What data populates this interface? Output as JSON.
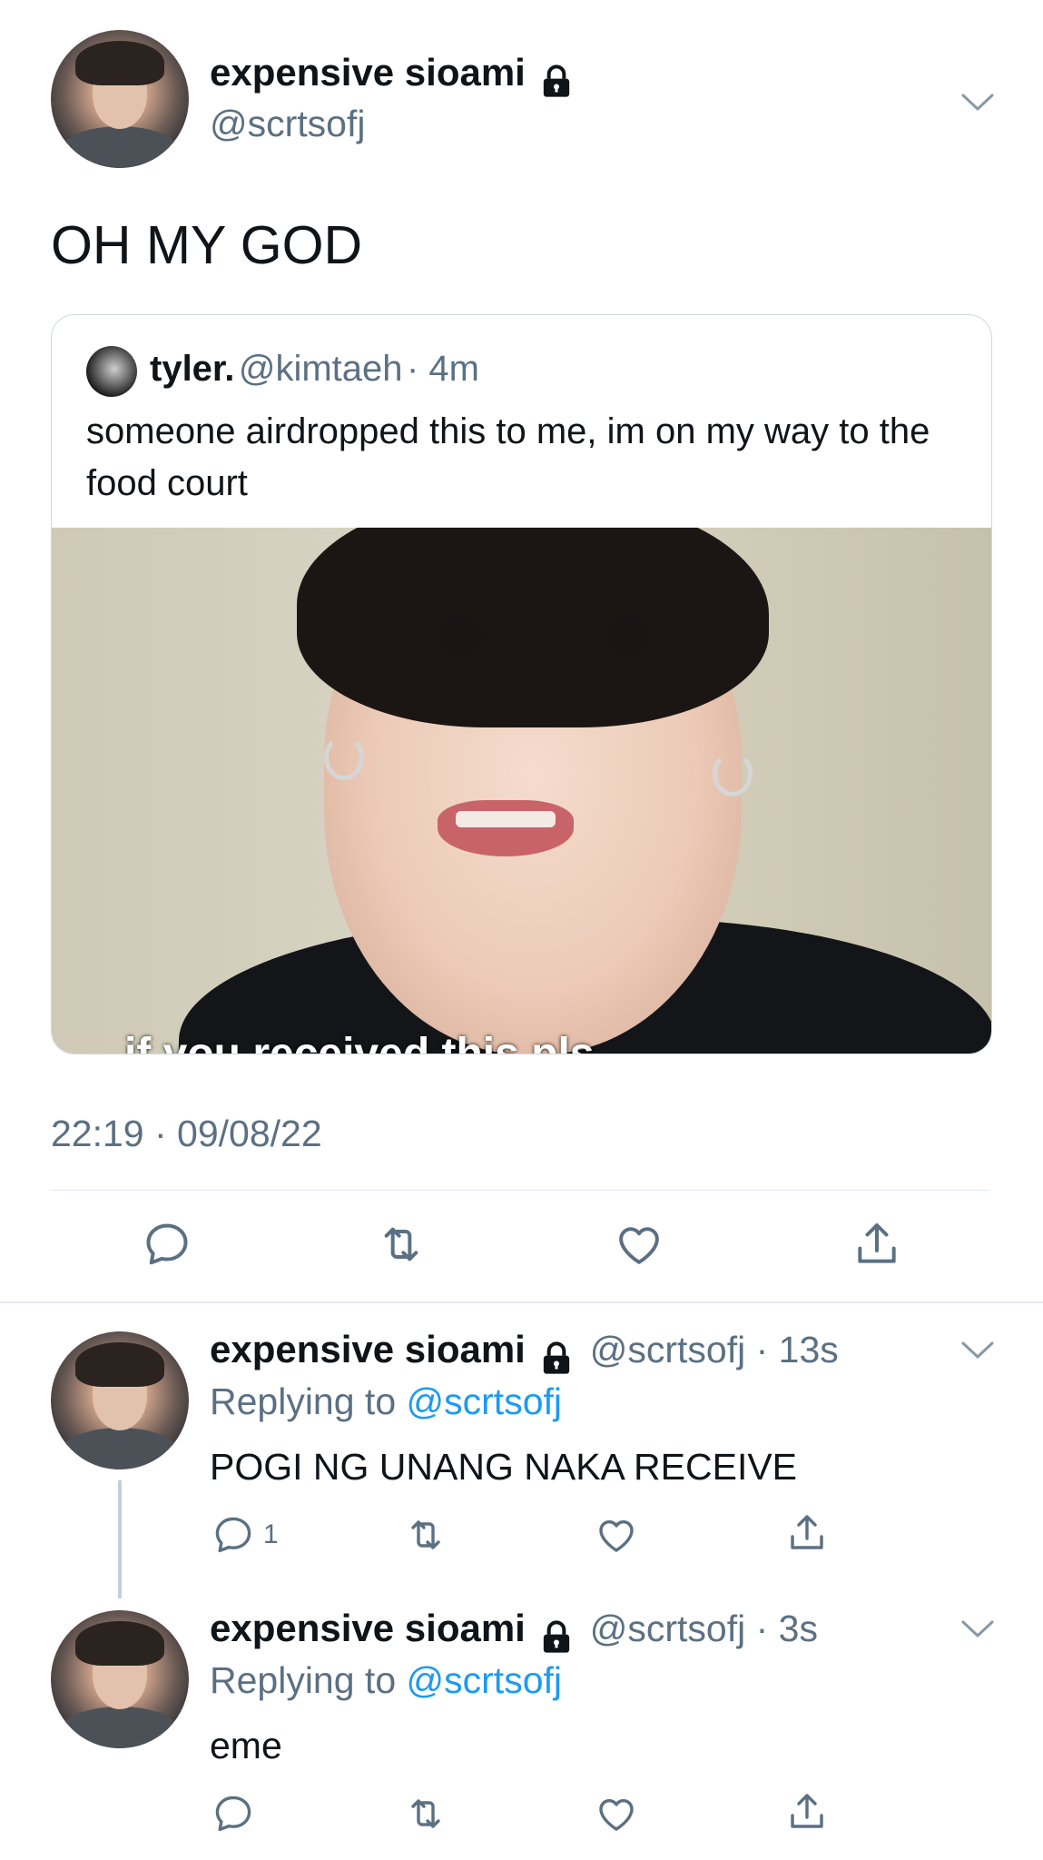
{
  "tweet": {
    "display_name": "expensive sioami",
    "handle": "@scrtsofj",
    "text": "OH MY GOD",
    "timestamp": "22:19 · 09/08/22",
    "quoted": {
      "display_name": "tyler.",
      "handle": "@kimtaeh",
      "age": "· 4m",
      "text": "someone airdropped this to me, im on my way to the food court",
      "image_caption": "if you received this pls"
    }
  },
  "replies": [
    {
      "display_name": "expensive sioami",
      "meta": "@scrtsofj · 13s",
      "replying_prefix": "Replying to",
      "replying_to": "@scrtsofj",
      "text": "POGI NG UNANG NAKA RECEIVE",
      "reply_count": "1"
    },
    {
      "display_name": "expensive sioami",
      "meta": "@scrtsofj · 3s",
      "replying_prefix": "Replying to",
      "replying_to": "@scrtsofj",
      "text": "eme",
      "reply_count": ""
    }
  ],
  "icons": {
    "lock": "lock-icon",
    "more": "chevron-down-icon",
    "reply": "reply-icon",
    "retweet": "retweet-icon",
    "like": "heart-icon",
    "share": "share-icon"
  },
  "colors": {
    "text": "#0f1419",
    "secondary": "#5b7083",
    "link": "#1d9bf0",
    "border": "#cfd9de"
  }
}
